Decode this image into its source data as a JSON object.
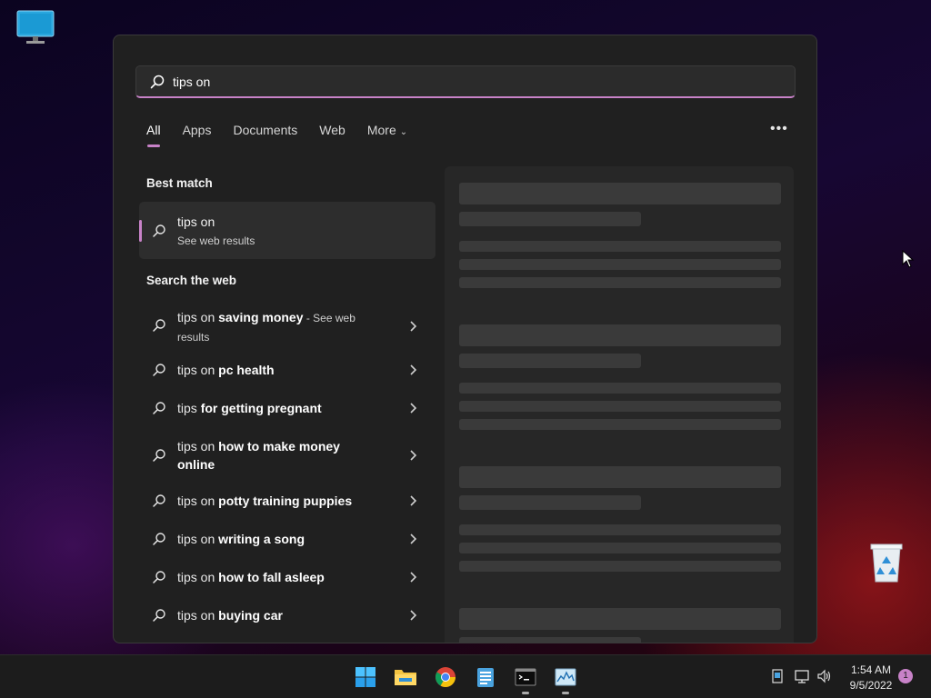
{
  "search": {
    "value": "tips on",
    "placeholder": ""
  },
  "tabs": [
    {
      "label": "All",
      "active": true
    },
    {
      "label": "Apps"
    },
    {
      "label": "Documents"
    },
    {
      "label": "Web"
    },
    {
      "label": "More"
    }
  ],
  "sections": {
    "best_match": "Best match",
    "search_web": "Search the web"
  },
  "best_match": {
    "title": "tips on",
    "subtitle": "See web results"
  },
  "web_results": [
    {
      "prefix": "tips on ",
      "bold": "saving money",
      "suffix": " - See web results"
    },
    {
      "prefix": "tips on ",
      "bold": "pc health",
      "suffix": ""
    },
    {
      "prefix": "tips ",
      "bold": "for getting pregnant",
      "suffix": ""
    },
    {
      "prefix": "tips on ",
      "bold": "how to make money online",
      "suffix": ""
    },
    {
      "prefix": "tips on ",
      "bold": "potty training puppies",
      "suffix": ""
    },
    {
      "prefix": "tips on ",
      "bold": "writing a song",
      "suffix": ""
    },
    {
      "prefix": "tips on ",
      "bold": "how to fall asleep",
      "suffix": ""
    },
    {
      "prefix": "tips on ",
      "bold": "buying car",
      "suffix": ""
    }
  ],
  "taskbar": {
    "apps": [
      "start-icon",
      "file-explorer-icon",
      "chrome-icon",
      "notepad-icon",
      "terminal-icon",
      "task-manager-icon"
    ],
    "tray": [
      "device-icon",
      "network-icon",
      "volume-icon"
    ],
    "time": "1:54 AM",
    "date": "9/5/2022",
    "notification_count": "1"
  },
  "colors": {
    "accent": "#c882c8",
    "panel": "#202020",
    "taskbar": "#1c1c1c"
  }
}
